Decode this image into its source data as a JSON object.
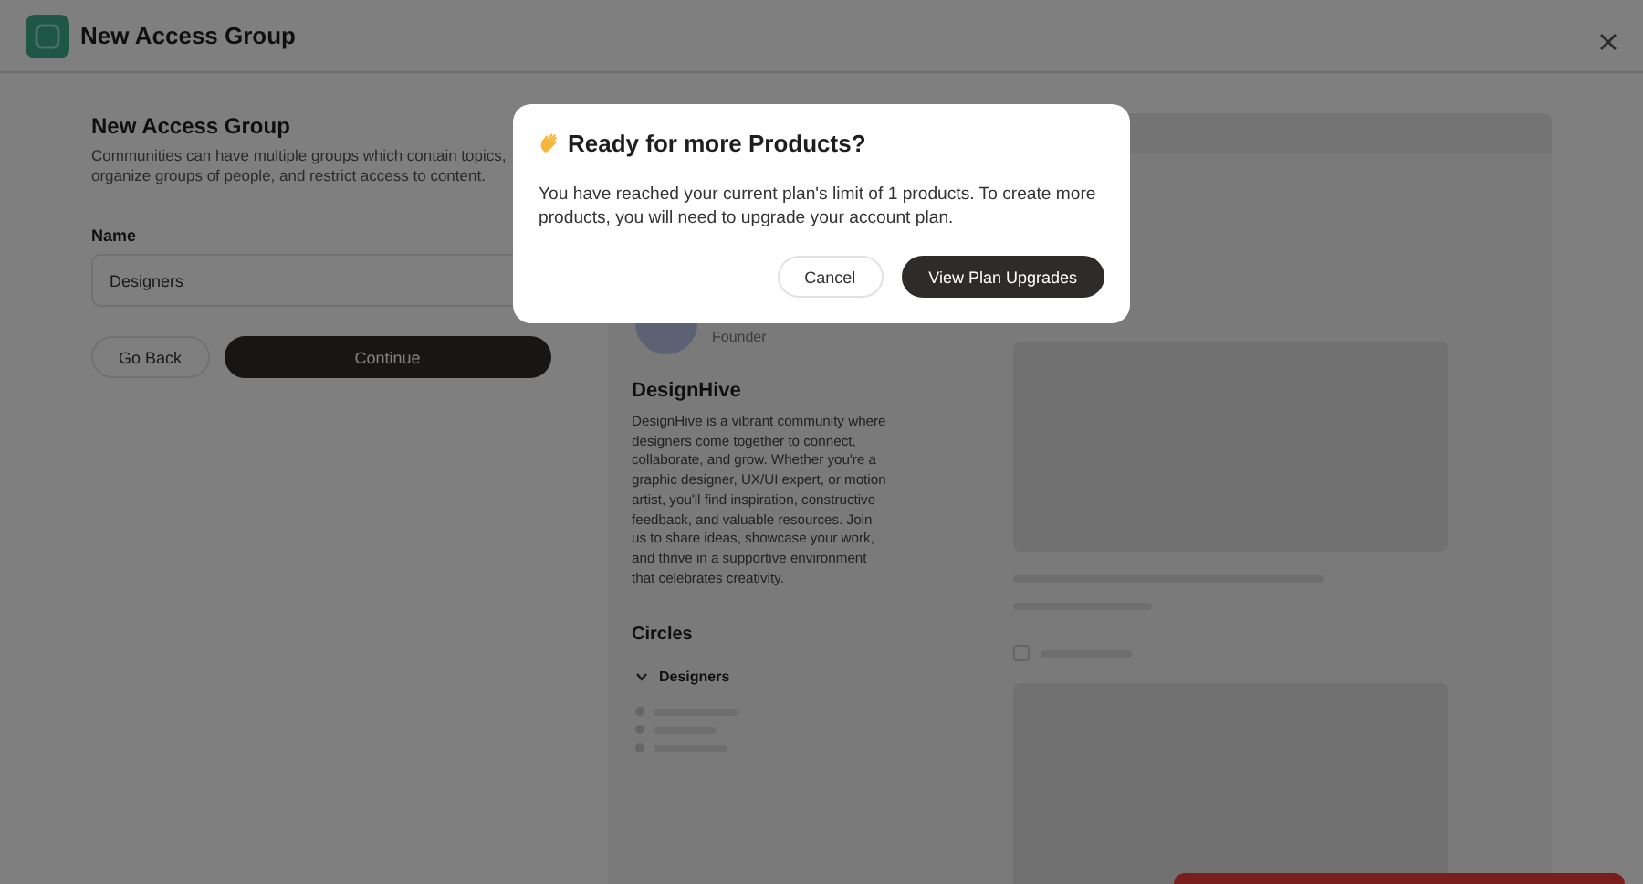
{
  "header": {
    "title": "New Access Group"
  },
  "form": {
    "title": "New Access Group",
    "description": "Communities can have multiple groups which contain topics, organize groups of people, and restrict access to content.",
    "name_label": "Name",
    "name_value": "Designers",
    "buttons": [
      {
        "label": "Go Back",
        "kind": "secondary"
      },
      {
        "label": "Continue",
        "kind": "primary"
      }
    ]
  },
  "preview": {
    "member_role": "Founder",
    "community_name": "DesignHive",
    "community_description": "DesignHive is a vibrant community where designers come together to connect, collaborate, and grow. Whether you're a graphic designer, UX/UI expert, or motion artist, you'll find inspiration, constructive feedback, and valuable resources. Join us to share ideas, showcase your work, and thrive in a supportive environment that celebrates creativity.",
    "circles_heading": "Circles",
    "circles": [
      {
        "label": "Designers",
        "expanded": true
      }
    ],
    "option": {
      "checked": false
    }
  },
  "dialog": {
    "title": "Ready for more Products?",
    "message": "You have reached your current plan's limit of 1 products. To create more products, you will need to upgrade your account plan.",
    "buttons": [
      {
        "label": "Cancel",
        "kind": "secondary"
      },
      {
        "label": "View Plan Upgrades",
        "kind": "primary"
      }
    ]
  }
}
